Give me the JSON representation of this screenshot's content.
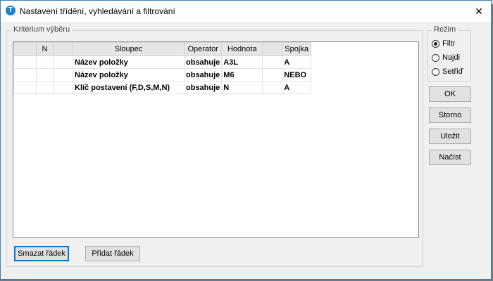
{
  "window": {
    "title": "Nastavení třídění, vyhledávání a filtrování",
    "icon_letter": "T",
    "close_glyph": "✕"
  },
  "criteria_group": {
    "label": "Kritérium výběru"
  },
  "grid": {
    "columns": [
      "",
      "N",
      "",
      "Sloupec",
      "Operator",
      "Hodnota",
      "",
      "Spojka"
    ],
    "rows": [
      {
        "sloupec": "Název položky",
        "operator": "obsahuje",
        "hodnota": "A3L",
        "spojka": "A"
      },
      {
        "sloupec": "Název položky",
        "operator": "obsahuje",
        "hodnota": "M6",
        "spojka": "NEBO"
      },
      {
        "sloupec": "Klíč postavení (F,D,S,M,N)",
        "operator": "obsahuje",
        "hodnota": "N",
        "spojka": "A"
      }
    ]
  },
  "mode_group": {
    "label": "Režim",
    "options": [
      {
        "label": "Filtr",
        "selected": true
      },
      {
        "label": "Najdi",
        "selected": false
      },
      {
        "label": "Setřiď",
        "selected": false
      }
    ]
  },
  "buttons": {
    "ok": "OK",
    "storno": "Storno",
    "ulozit": "Uložit",
    "nacist": "Načíst",
    "smazat": "Smazat řádek",
    "pridat": "Přidat řádek"
  },
  "colors": {
    "accent": "#0078d7",
    "window_border": "#3c7fb1",
    "icon": "#1e7fd1"
  }
}
